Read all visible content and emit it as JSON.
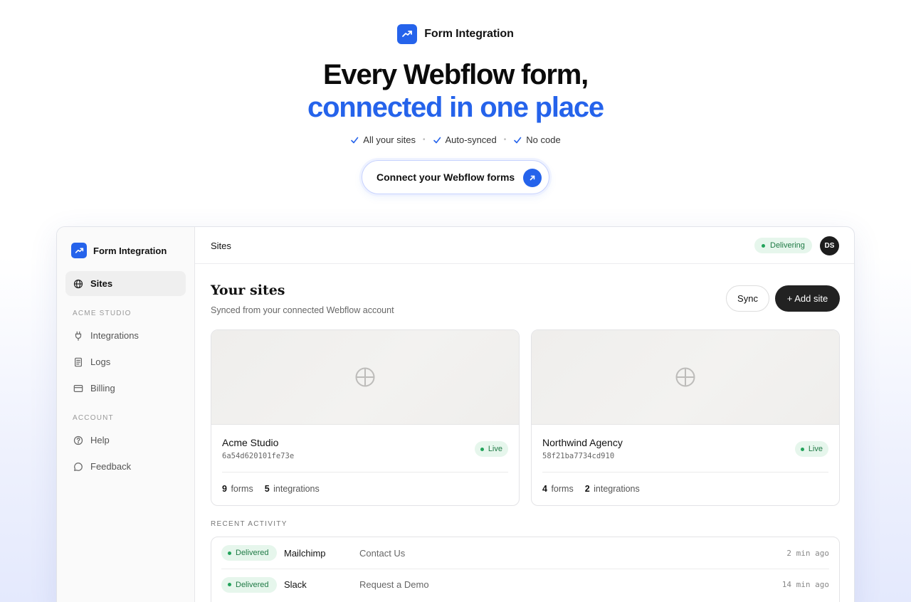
{
  "hero": {
    "brand": "Form Integration",
    "title_line1": "Every Webflow form,",
    "title_line2": "connected in one place",
    "checks": [
      "All your sites",
      "Auto-synced",
      "No code"
    ],
    "cta_label": "Connect your Webflow forms"
  },
  "sidebar": {
    "brand": "Form Integration",
    "sites_label": "Sites",
    "section_workspace": "ACME STUDIO",
    "workspace_items": [
      "Integrations",
      "Logs",
      "Billing"
    ],
    "section_account": "ACCOUNT",
    "account_items": [
      "Help",
      "Feedback"
    ]
  },
  "topbar": {
    "breadcrumb": "Sites",
    "status": "Delivering",
    "avatar_initials": "DS"
  },
  "main": {
    "title": "Your sites",
    "subtitle": "Synced from your connected Webflow account",
    "sync_label": "Sync",
    "add_site_label": "+ Add site",
    "recent_activity_label": "RECENT ACTIVITY"
  },
  "sites": [
    {
      "name": "Acme Studio",
      "id": "6a54d620101fe73e",
      "status": "Live",
      "forms_count": "9",
      "forms_label": "forms",
      "integrations_count": "5",
      "integrations_label": "integrations"
    },
    {
      "name": "Northwind Agency",
      "id": "58f21ba7734cd910",
      "status": "Live",
      "forms_count": "4",
      "forms_label": "forms",
      "integrations_count": "2",
      "integrations_label": "integrations"
    }
  ],
  "activity": [
    {
      "status": "Delivered",
      "service": "Mailchimp",
      "form": "Contact Us",
      "time": "2 min ago"
    },
    {
      "status": "Delivered",
      "service": "Slack",
      "form": "Request a Demo",
      "time": "14 min ago"
    }
  ],
  "colors": {
    "accent": "#2563eb",
    "success_bg": "#e6f6ec",
    "success_text": "#1f7a45",
    "dark_button": "#222222"
  }
}
